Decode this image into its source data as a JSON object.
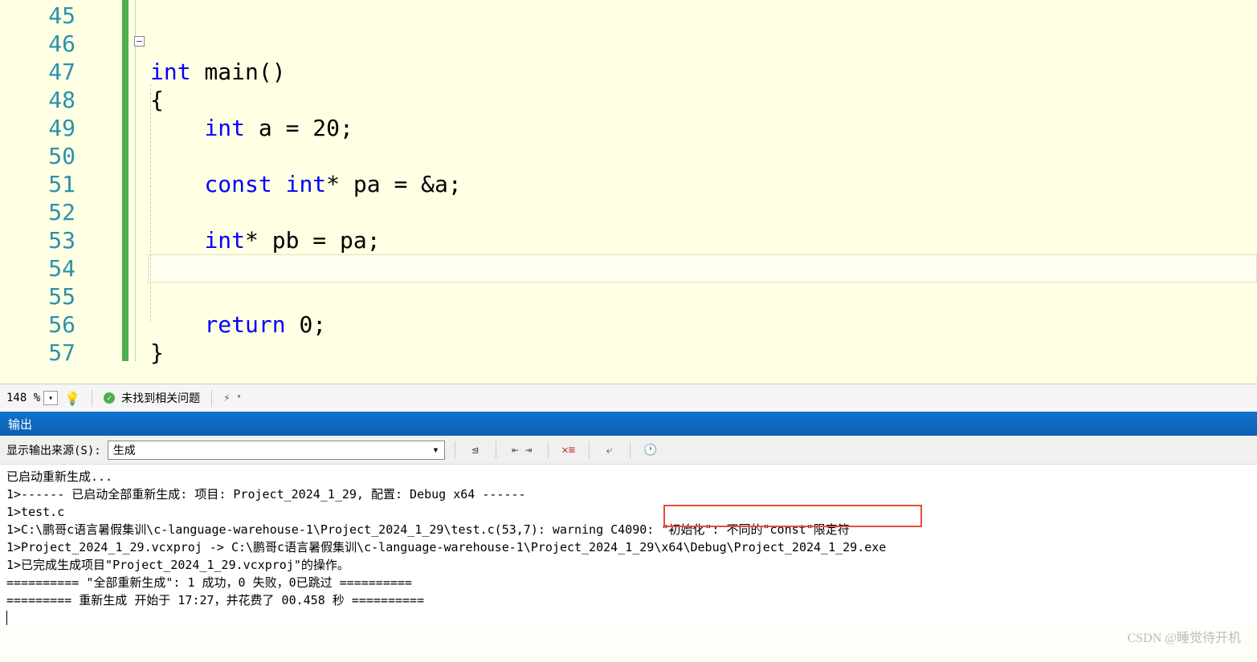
{
  "editor": {
    "lines": [
      {
        "num": "45",
        "tokens": []
      },
      {
        "num": "46",
        "tokens": []
      },
      {
        "num": "47",
        "tokens": [
          {
            "t": "kw",
            "v": "int"
          },
          {
            "t": "txt",
            "v": " main()"
          }
        ]
      },
      {
        "num": "48",
        "tokens": [
          {
            "t": "txt",
            "v": "{"
          }
        ]
      },
      {
        "num": "49",
        "tokens": [
          {
            "t": "txt",
            "v": "    "
          },
          {
            "t": "kw",
            "v": "int"
          },
          {
            "t": "txt",
            "v": " a = 20;"
          }
        ]
      },
      {
        "num": "50",
        "tokens": []
      },
      {
        "num": "51",
        "tokens": [
          {
            "t": "txt",
            "v": "    "
          },
          {
            "t": "kw",
            "v": "const"
          },
          {
            "t": "txt",
            "v": " "
          },
          {
            "t": "kw",
            "v": "int"
          },
          {
            "t": "txt",
            "v": "* pa = &a;"
          }
        ]
      },
      {
        "num": "52",
        "tokens": []
      },
      {
        "num": "53",
        "tokens": [
          {
            "t": "txt",
            "v": "    "
          },
          {
            "t": "kw",
            "v": "int"
          },
          {
            "t": "txt",
            "v": "* pb = pa;"
          }
        ]
      },
      {
        "num": "54",
        "tokens": [],
        "current": true
      },
      {
        "num": "55",
        "tokens": []
      },
      {
        "num": "56",
        "tokens": [
          {
            "t": "txt",
            "v": "    "
          },
          {
            "t": "kw",
            "v": "return"
          },
          {
            "t": "txt",
            "v": " 0;"
          }
        ]
      },
      {
        "num": "57",
        "tokens": [
          {
            "t": "txt",
            "v": "}"
          }
        ]
      }
    ]
  },
  "status": {
    "zoom": "148 %",
    "issues": "未找到相关问题"
  },
  "output": {
    "title": "输出",
    "source_label": "显示输出来源(S):",
    "source_value": "生成",
    "lines": [
      "已启动重新生成...",
      "1>------ 已启动全部重新生成: 项目: Project_2024_1_29, 配置: Debug x64 ------",
      "1>test.c",
      "1>C:\\鹏哥c语言暑假集训\\c-language-warehouse-1\\Project_2024_1_29\\test.c(53,7): warning C4090: \"初始化\": 不同的\"const\"限定符",
      "1>Project_2024_1_29.vcxproj -> C:\\鹏哥c语言暑假集训\\c-language-warehouse-1\\Project_2024_1_29\\x64\\Debug\\Project_2024_1_29.exe",
      "1>已完成生成项目\"Project_2024_1_29.vcxproj\"的操作。",
      "========== \"全部重新生成\": 1 成功，0 失败，0已跳过 ==========",
      "========= 重新生成 开始于 17:27，并花费了 00.458 秒 =========="
    ]
  },
  "watermark": "CSDN @睡觉待开机"
}
